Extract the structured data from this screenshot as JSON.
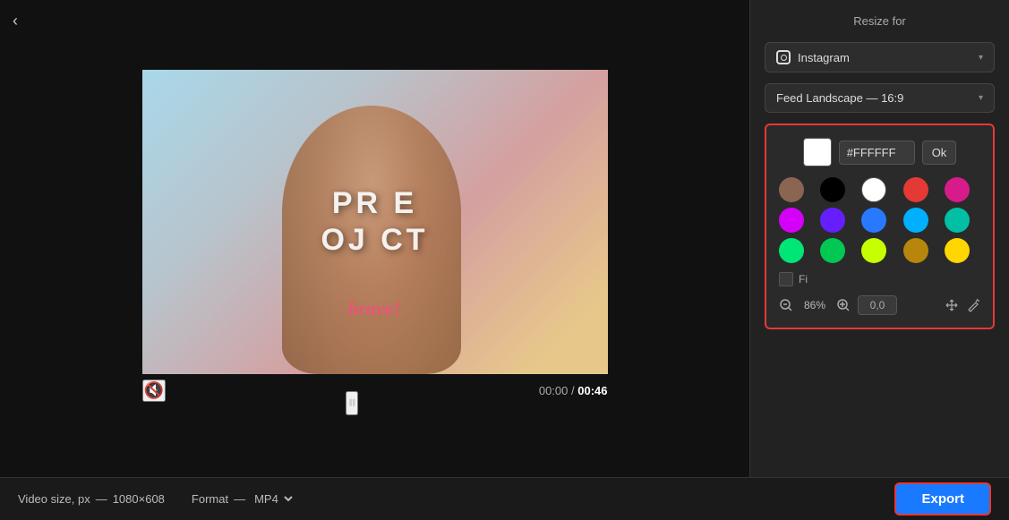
{
  "header": {
    "back_label": "‹"
  },
  "video": {
    "text_line1": "PR  E",
    "text_line2": "OJ  CT",
    "subtext": "brave!",
    "time_current": "00:00",
    "time_total": "00:46"
  },
  "right_panel": {
    "resize_label": "Resize for",
    "platform_dropdown": "Instagram",
    "format_dropdown": "Feed Landscape — 16:9",
    "color_picker": {
      "hex_value": "#FFFFFF",
      "ok_label": "Ok",
      "swatches": [
        {
          "color": "#8B6452",
          "name": "brown"
        },
        {
          "color": "#000000",
          "name": "black"
        },
        {
          "color": "#FFFFFF",
          "name": "white"
        },
        {
          "color": "#E53935",
          "name": "red"
        },
        {
          "color": "#D81B8A",
          "name": "pink"
        },
        {
          "color": "#D500F9",
          "name": "magenta"
        },
        {
          "color": "#651FFF",
          "name": "purple"
        },
        {
          "color": "#2979FF",
          "name": "blue"
        },
        {
          "color": "#00B0FF",
          "name": "light-blue"
        },
        {
          "color": "#00BFA5",
          "name": "teal"
        },
        {
          "color": "#00E676",
          "name": "green"
        },
        {
          "color": "#00C853",
          "name": "dark-green"
        },
        {
          "color": "#C6FF00",
          "name": "lime"
        },
        {
          "color": "#B8860B",
          "name": "dark-gold"
        },
        {
          "color": "#FFD600",
          "name": "yellow"
        }
      ],
      "fill_label": "Fi",
      "zoom_pct": "86%",
      "position": "0,0"
    }
  },
  "bottom_bar": {
    "video_size_label": "Video size, px",
    "video_size_sep": "—",
    "video_size_value": "1080×608",
    "format_label": "Format",
    "format_sep": "—",
    "format_value": "MP4",
    "export_label": "Export"
  }
}
